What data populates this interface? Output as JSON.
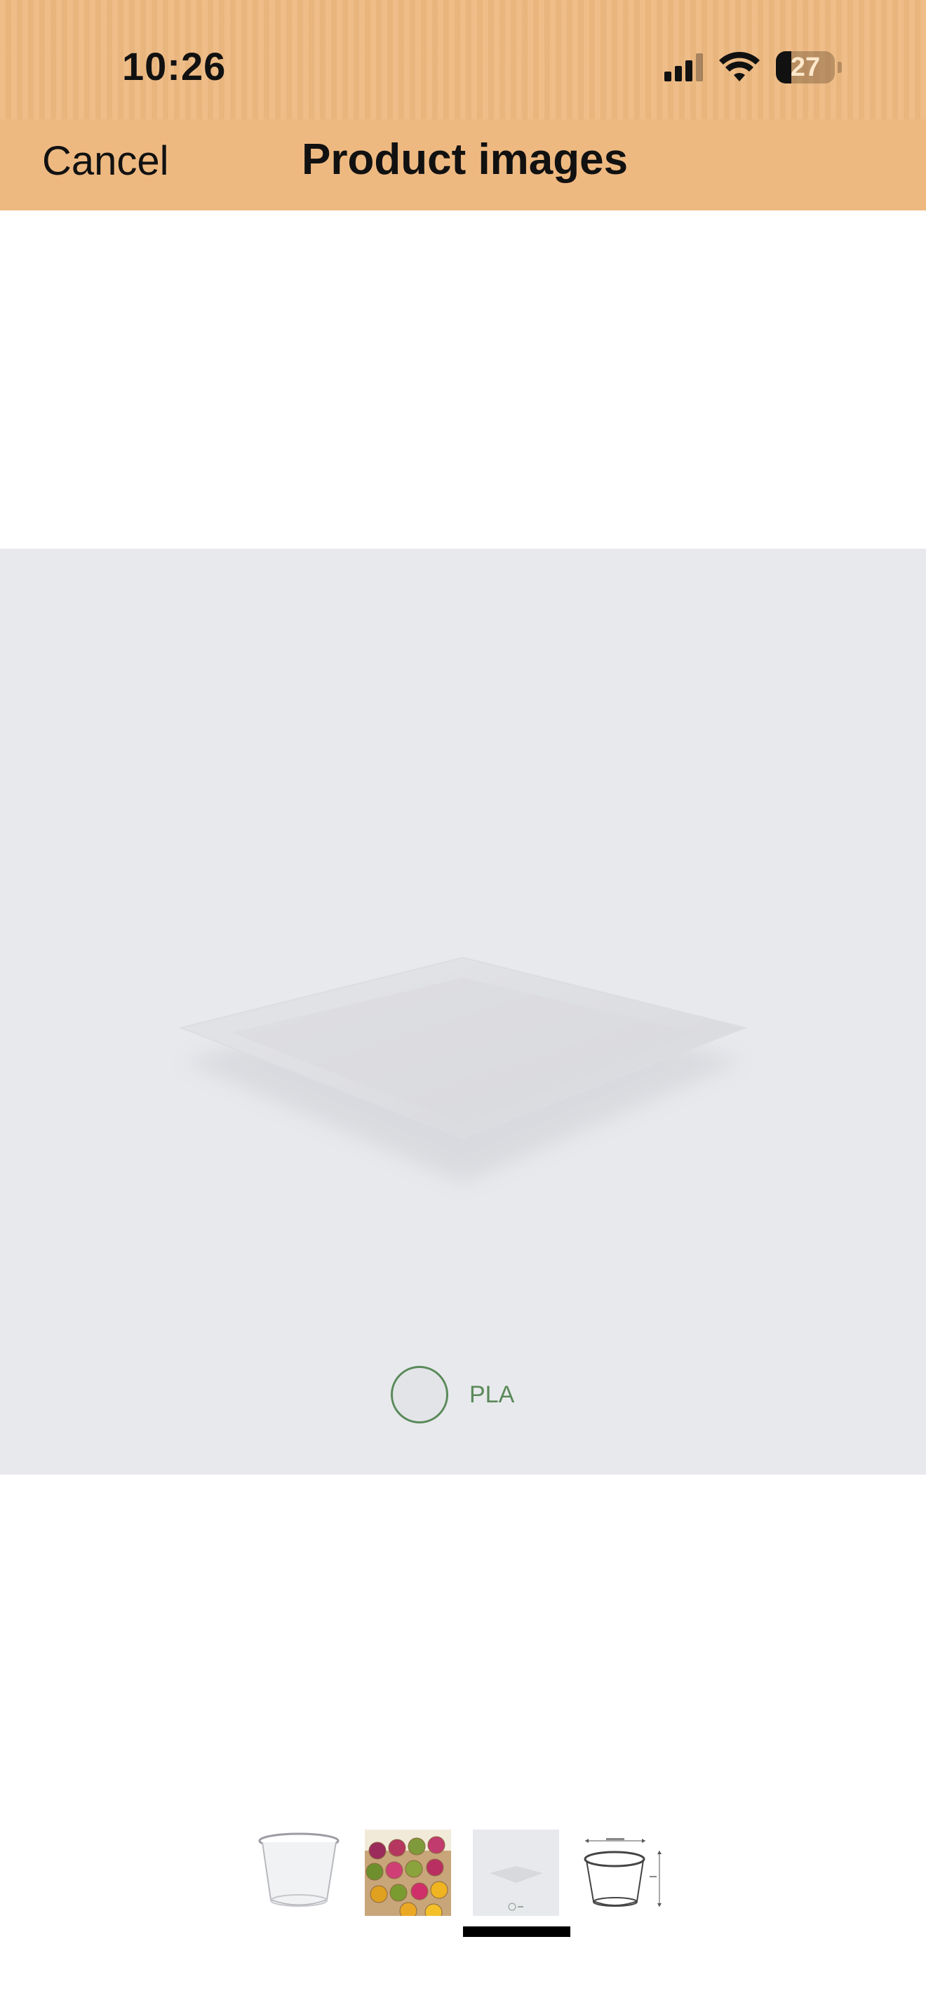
{
  "status_bar": {
    "time": "10:26",
    "battery": "27",
    "icons": [
      "signal-icon",
      "wifi-icon",
      "battery-icon"
    ]
  },
  "nav": {
    "cancel_label": "Cancel",
    "title": "Product images"
  },
  "main_image": {
    "description_icon": "flat-lid-sheet-image",
    "material": "PLA"
  },
  "thumbnails": [
    {
      "name": "clear-cup-thumbnail"
    },
    {
      "name": "colorful-drinks-thumbnail"
    },
    {
      "name": "flat-lid-thumbnail",
      "selected": true
    },
    {
      "name": "cup-dimensions-thumbnail"
    }
  ],
  "colors": {
    "header_bg": "#eeb981",
    "image_bg": "#e8e9ed",
    "material_accent": "#5a8a5a"
  }
}
